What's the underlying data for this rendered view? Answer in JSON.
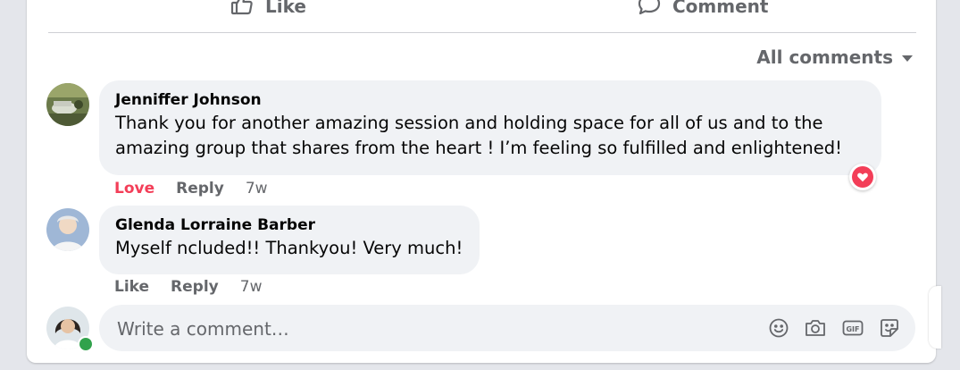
{
  "actions": {
    "like_label": "Like",
    "comment_label": "Comment"
  },
  "filter": {
    "label": "All comments"
  },
  "comments": [
    {
      "author": "Jenniffer Johnson",
      "lines": [
        "Thank you for another amazing session and holding space for all of us and to the",
        "amazing group that shares from the heart ! I’m feeling so fulfilled and enlightened!"
      ],
      "reaction_label": "Love",
      "reply_label": "Reply",
      "time": "7w",
      "reaction_icon": "heart-icon"
    },
    {
      "author": "Glenda Lorraine Barber",
      "lines": [
        "Myself ncluded!! Thankyou! Very much!"
      ],
      "reaction_label": "Like",
      "reply_label": "Reply",
      "time": "7w"
    }
  ],
  "composer": {
    "placeholder": "Write a comment…",
    "tools": [
      "emoji-icon",
      "camera-icon",
      "gif-icon",
      "sticker-icon"
    ]
  },
  "colors": {
    "love": "#f33e58",
    "muted": "#65676b",
    "bubble": "#f0f2f5",
    "online": "#31a24c"
  }
}
